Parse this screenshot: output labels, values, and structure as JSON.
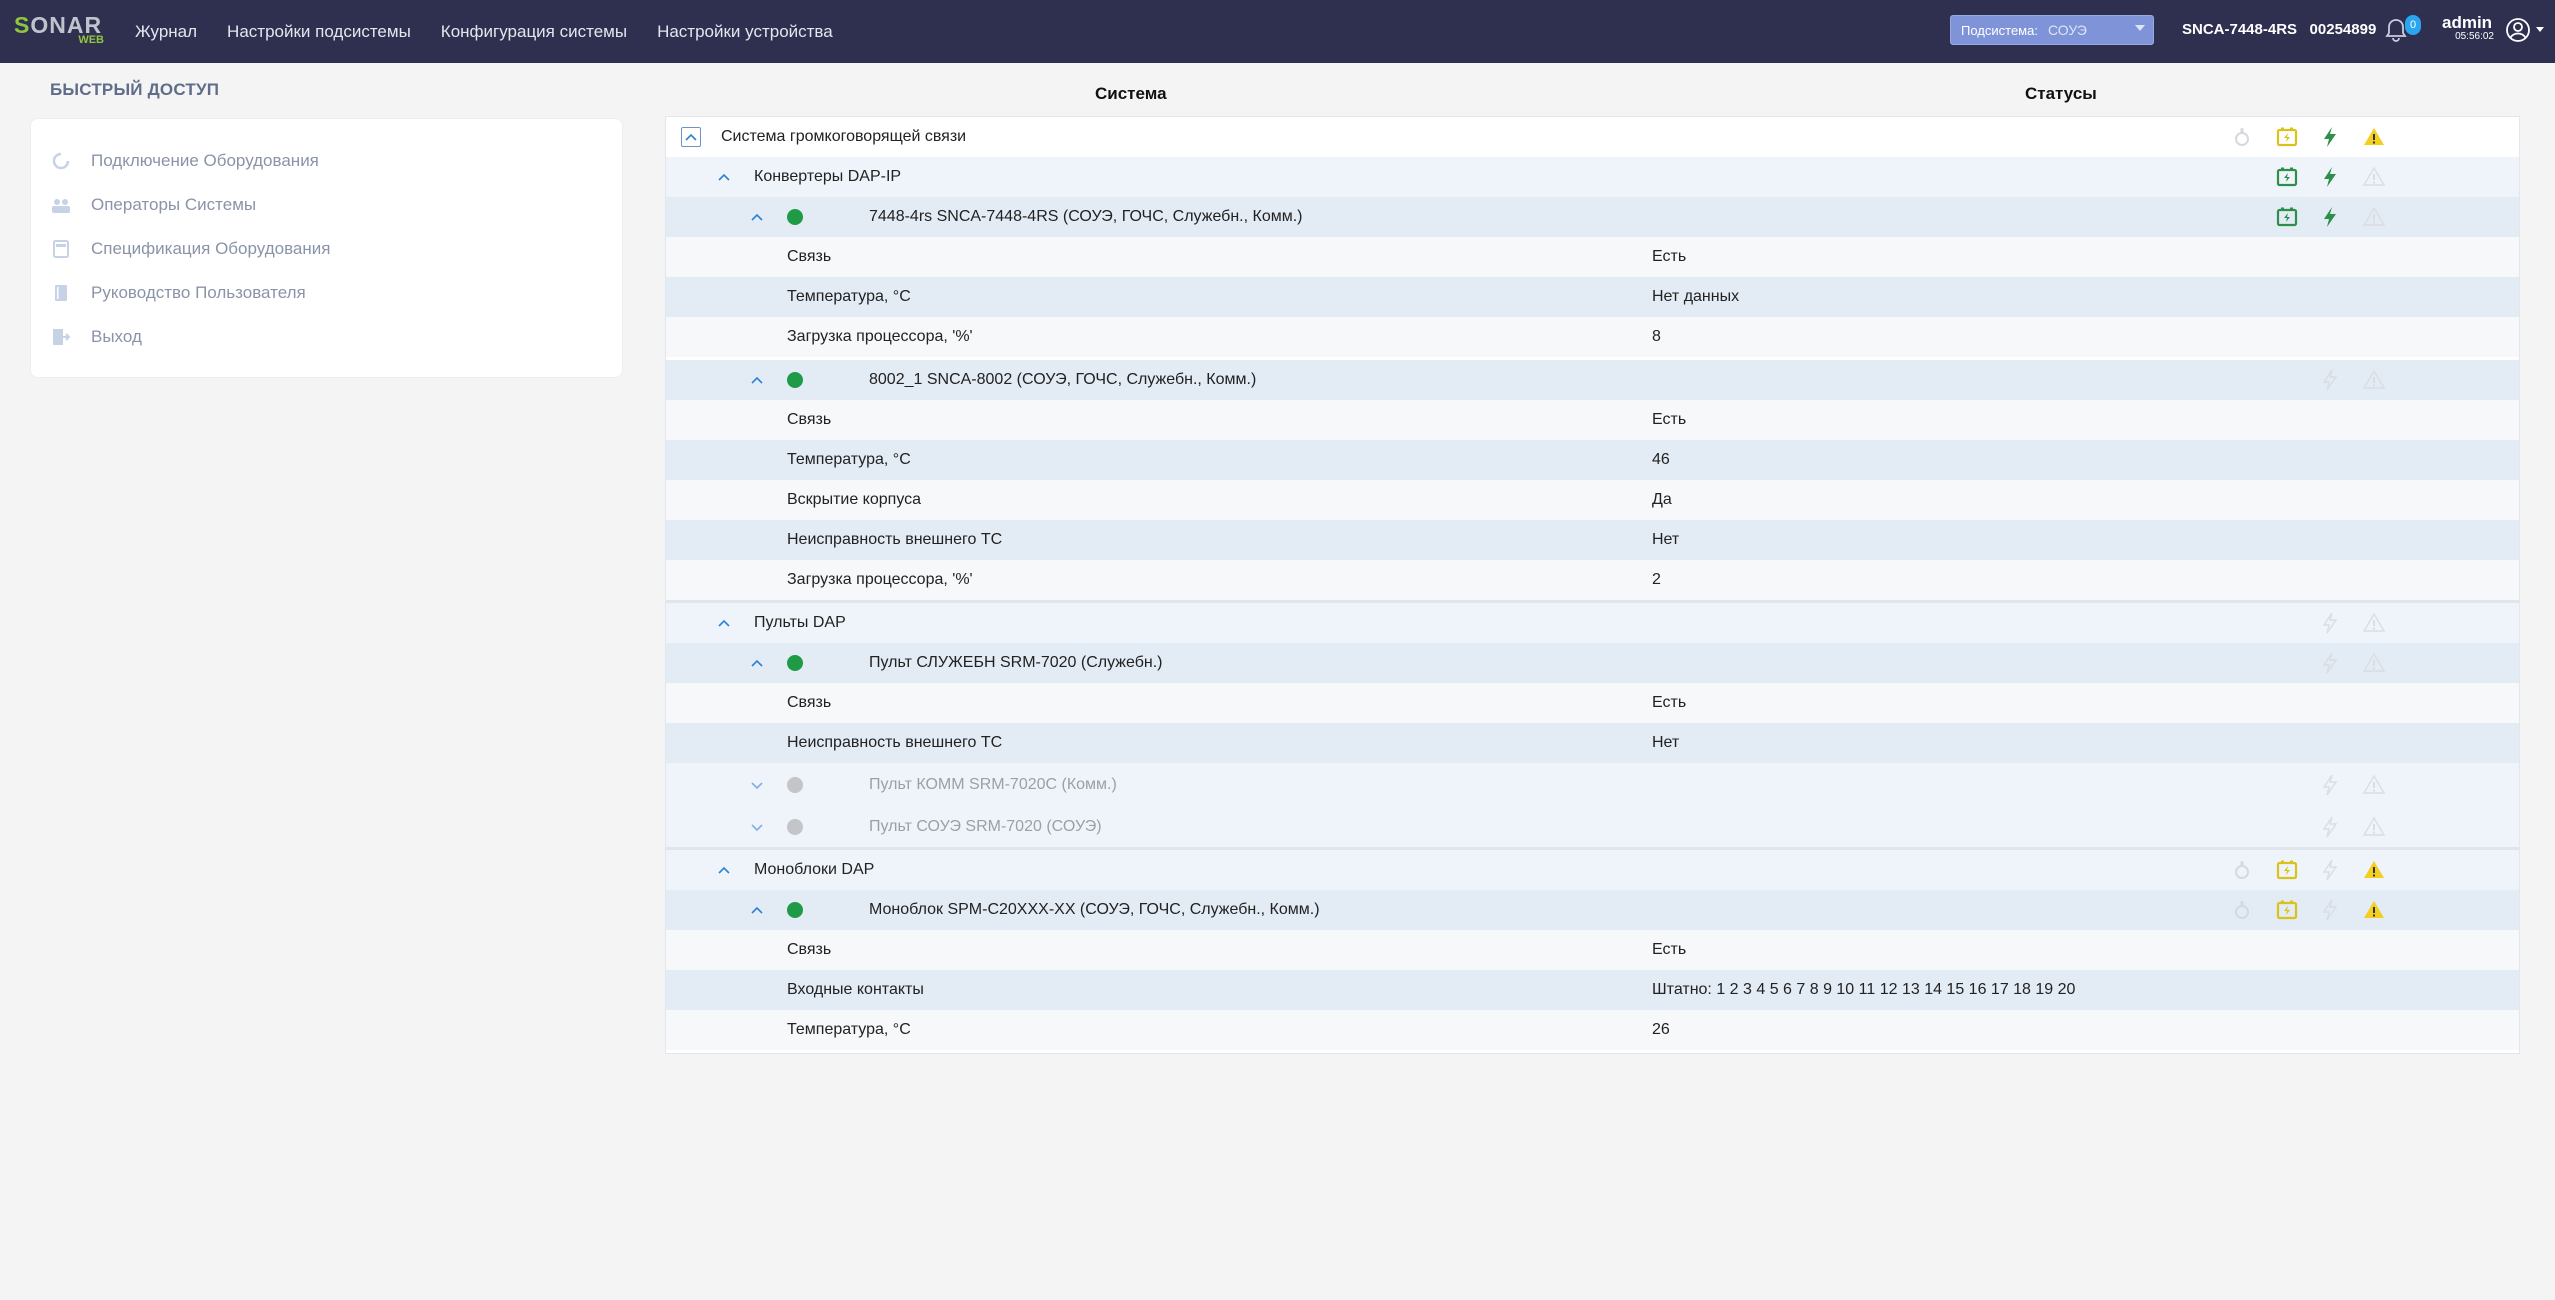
{
  "app": {
    "logo_main": "SONAR",
    "logo_sub": "WEB",
    "nav": [
      "Журнал",
      "Настройки подсистемы",
      "Конфигурация системы",
      "Настройки устройства"
    ],
    "subsystem_label": "Подсистема:",
    "subsystem_value": "СОУЭ",
    "device": "SNCA-7448-4RS   00254899",
    "notifications": "0",
    "user": "admin",
    "time": "05:56:02"
  },
  "quick_access": {
    "title": "БЫСТРЫЙ ДОСТУП",
    "items": [
      "Подключение Оборудования",
      "Операторы Системы",
      "Спецификация Оборудования",
      "Руководство Пользователя",
      "Выход"
    ]
  },
  "headers": {
    "system": "Система",
    "statuses": "Статусы"
  },
  "tree": {
    "root": "Система громкоговорящей связи",
    "g1": "Конвертеры DAP-IP",
    "d1": "7448-4rs SNCA-7448-4RS (СОУЭ, ГОЧС, Служебн., Комм.)",
    "d1_params": [
      {
        "label": "Связь",
        "value": "Есть"
      },
      {
        "label": "Температура, °С",
        "value": "Нет данных"
      },
      {
        "label": "Загрузка процессора, '%'",
        "value": "8"
      }
    ],
    "d2": "8002_1 SNCA-8002 (СОУЭ, ГОЧС, Служебн., Комм.)",
    "d2_params": [
      {
        "label": "Связь",
        "value": "Есть"
      },
      {
        "label": "Температура, °С",
        "value": "46"
      },
      {
        "label": "Вскрытие корпуса",
        "value": "Да"
      },
      {
        "label": "Неисправность внешнего ТС",
        "value": "Нет"
      },
      {
        "label": "Загрузка процессора, '%'",
        "value": "2"
      }
    ],
    "g2": "Пульты DAP",
    "d3": "Пульт СЛУЖЕБН SRM-7020 (Служебн.)",
    "d3_params": [
      {
        "label": "Связь",
        "value": "Есть"
      },
      {
        "label": "Неисправность внешнего ТС",
        "value": "Нет"
      }
    ],
    "d4": "Пульт КОММ SRM-7020C (Комм.)",
    "d5": "Пульт СОУЭ SRM-7020 (СОУЭ)",
    "g3": "Моноблоки DAP",
    "d6": "Моноблок SPM-C20XXX-XX (СОУЭ, ГОЧС, Служебн., Комм.)",
    "d6_params": [
      {
        "label": "Связь",
        "value": "Есть"
      },
      {
        "label": "Входные контакты",
        "value": "Штатно: 1 2 3 4 5 6 7 8 9 10 11 12 13 14 15 16 17 18 19 20"
      },
      {
        "label": "Температура, °С",
        "value": "26"
      }
    ]
  },
  "colors": {
    "nav_bg": "#2f3050",
    "accent": "#7f94d8",
    "ok": "#1f9b48",
    "battery": "#2e8f4a",
    "warning": "#f3d020",
    "muted": "#d5d8de"
  }
}
